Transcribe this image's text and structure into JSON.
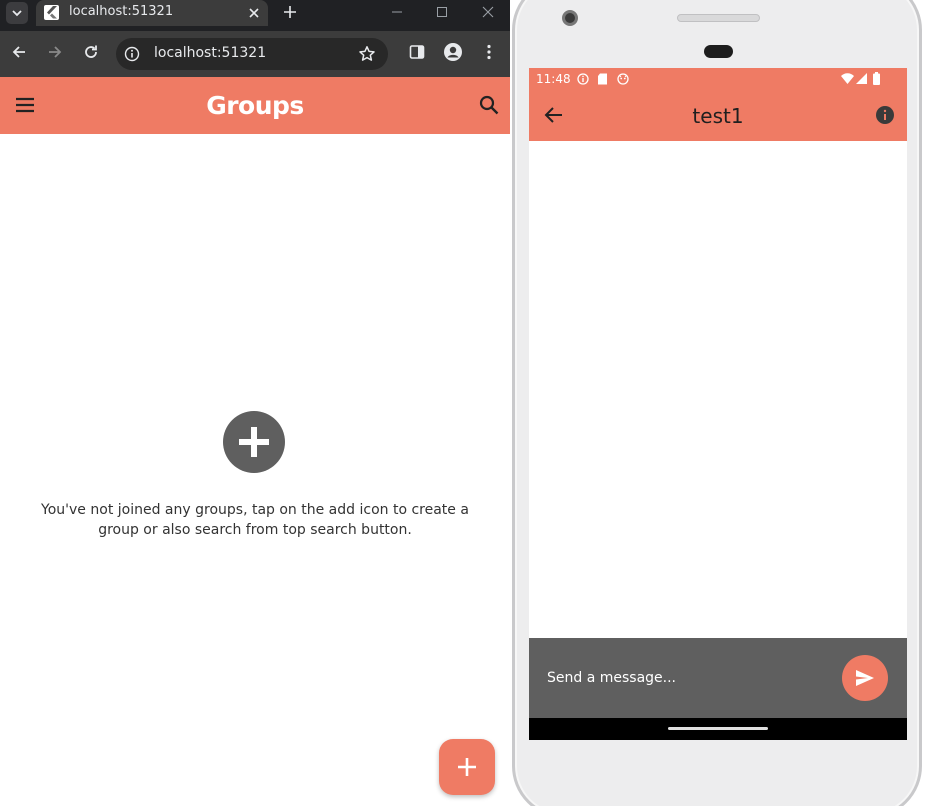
{
  "browser": {
    "tab_title": "localhost:51321",
    "url": "localhost:51321"
  },
  "app": {
    "title": "Groups",
    "empty_message": "You've not joined any groups, tap on the add icon to create a group or also search from top search button."
  },
  "phone": {
    "status_time": "11:48",
    "chat_title": "test1",
    "message_placeholder": "Send a message..."
  },
  "colors": {
    "accent": "#ef7b64",
    "dark_gray": "#5f5f5f",
    "browser_dark": "#3c3c3c"
  },
  "icons": {
    "menu": "menu-icon",
    "search": "search-icon",
    "add": "add-icon",
    "back": "arrow-back-icon",
    "info": "info-icon",
    "send": "send-icon"
  }
}
